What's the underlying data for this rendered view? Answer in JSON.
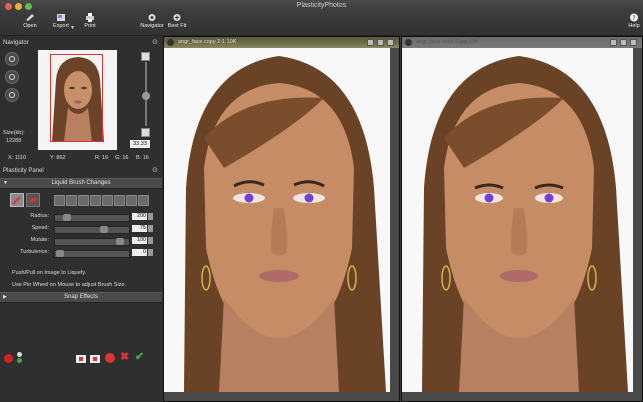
{
  "window": {
    "title": "PlasticityPhotos"
  },
  "toolbar": {
    "open": "Open",
    "export": "Export",
    "print": "Print",
    "navigator": "Navigator",
    "best_fit": "Best Fit",
    "help": "Help"
  },
  "navigator": {
    "title": "Navigator",
    "size_label": "Size(kb):",
    "size_value": "12288",
    "zoom_value": "33.33",
    "x": "X: 1110",
    "y": "Y: 862",
    "r": "R: 16",
    "g": "G: 16",
    "b": "B: 16"
  },
  "plasticity_panel": {
    "title": "Plasticity Panel",
    "section_title": "Liquid Brush Changes",
    "params": [
      {
        "label": "Radius:",
        "value": "200",
        "fraction": 0.12
      },
      {
        "label": "Speed:",
        "value": "75",
        "fraction": 0.68
      },
      {
        "label": "Mutate:",
        "value": "100",
        "fraction": 0.92
      },
      {
        "label": "Turbulence:",
        "value": "0",
        "fraction": 0.02
      }
    ],
    "hint1": "Push/Pull on Image to Liquefy.",
    "hint2": "Use Pin Wheel on Mouse to adjust Brush Size.",
    "snap_effects": "Snap Effects"
  },
  "documents": [
    {
      "title": "angr_face copy 2-1 10K"
    },
    {
      "title": "angr_face copy 2.jpg 10K"
    }
  ],
  "colors": {
    "accent_red": "#d33333",
    "accent_green": "#3fae3f",
    "eye_purple": "#7a3fd0"
  }
}
